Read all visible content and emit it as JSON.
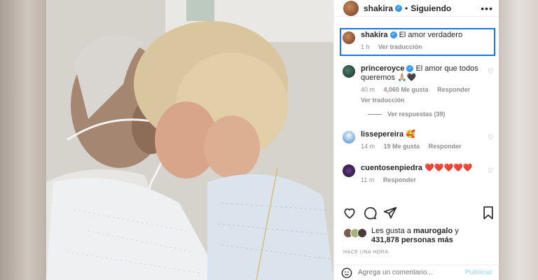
{
  "header": {
    "username": "shakira",
    "separator": "•",
    "following_label": "Siguiendo",
    "more_icon": "more-icon"
  },
  "caption": {
    "username": "shakira",
    "text": "El amor verdadero",
    "time": "1 h",
    "translate": "Ver traducción"
  },
  "comments": [
    {
      "username": "princeroyce",
      "verified": true,
      "text": "El amor que todos queremos 🙏🏼🖤",
      "time": "40 m",
      "likes": "4,060 Me gusta",
      "reply": "Responder",
      "translate": "Ver traducción",
      "replies": "Ver respuestas (39)"
    },
    {
      "username": "lissepereira",
      "verified": false,
      "text": "🥰",
      "time": "14 m",
      "likes": "19 Me gusta",
      "reply": "Responder"
    },
    {
      "username": "cuentosenpiedra",
      "verified": false,
      "text": "❤️❤️❤️❤️❤️",
      "time": "11 m",
      "reply": "Responder"
    }
  ],
  "likes": {
    "prefix": "Les gusta a",
    "user": "maurogalo",
    "connector": "y",
    "count": "431,878 personas más"
  },
  "timestamp": "HACE UNA HORA",
  "composer": {
    "placeholder": "Agrega un comentario...",
    "publish": "Publicar"
  },
  "colors": {
    "verified": "#3897f0",
    "highlight": "#1a73e8",
    "publish": "#b2dffc"
  }
}
